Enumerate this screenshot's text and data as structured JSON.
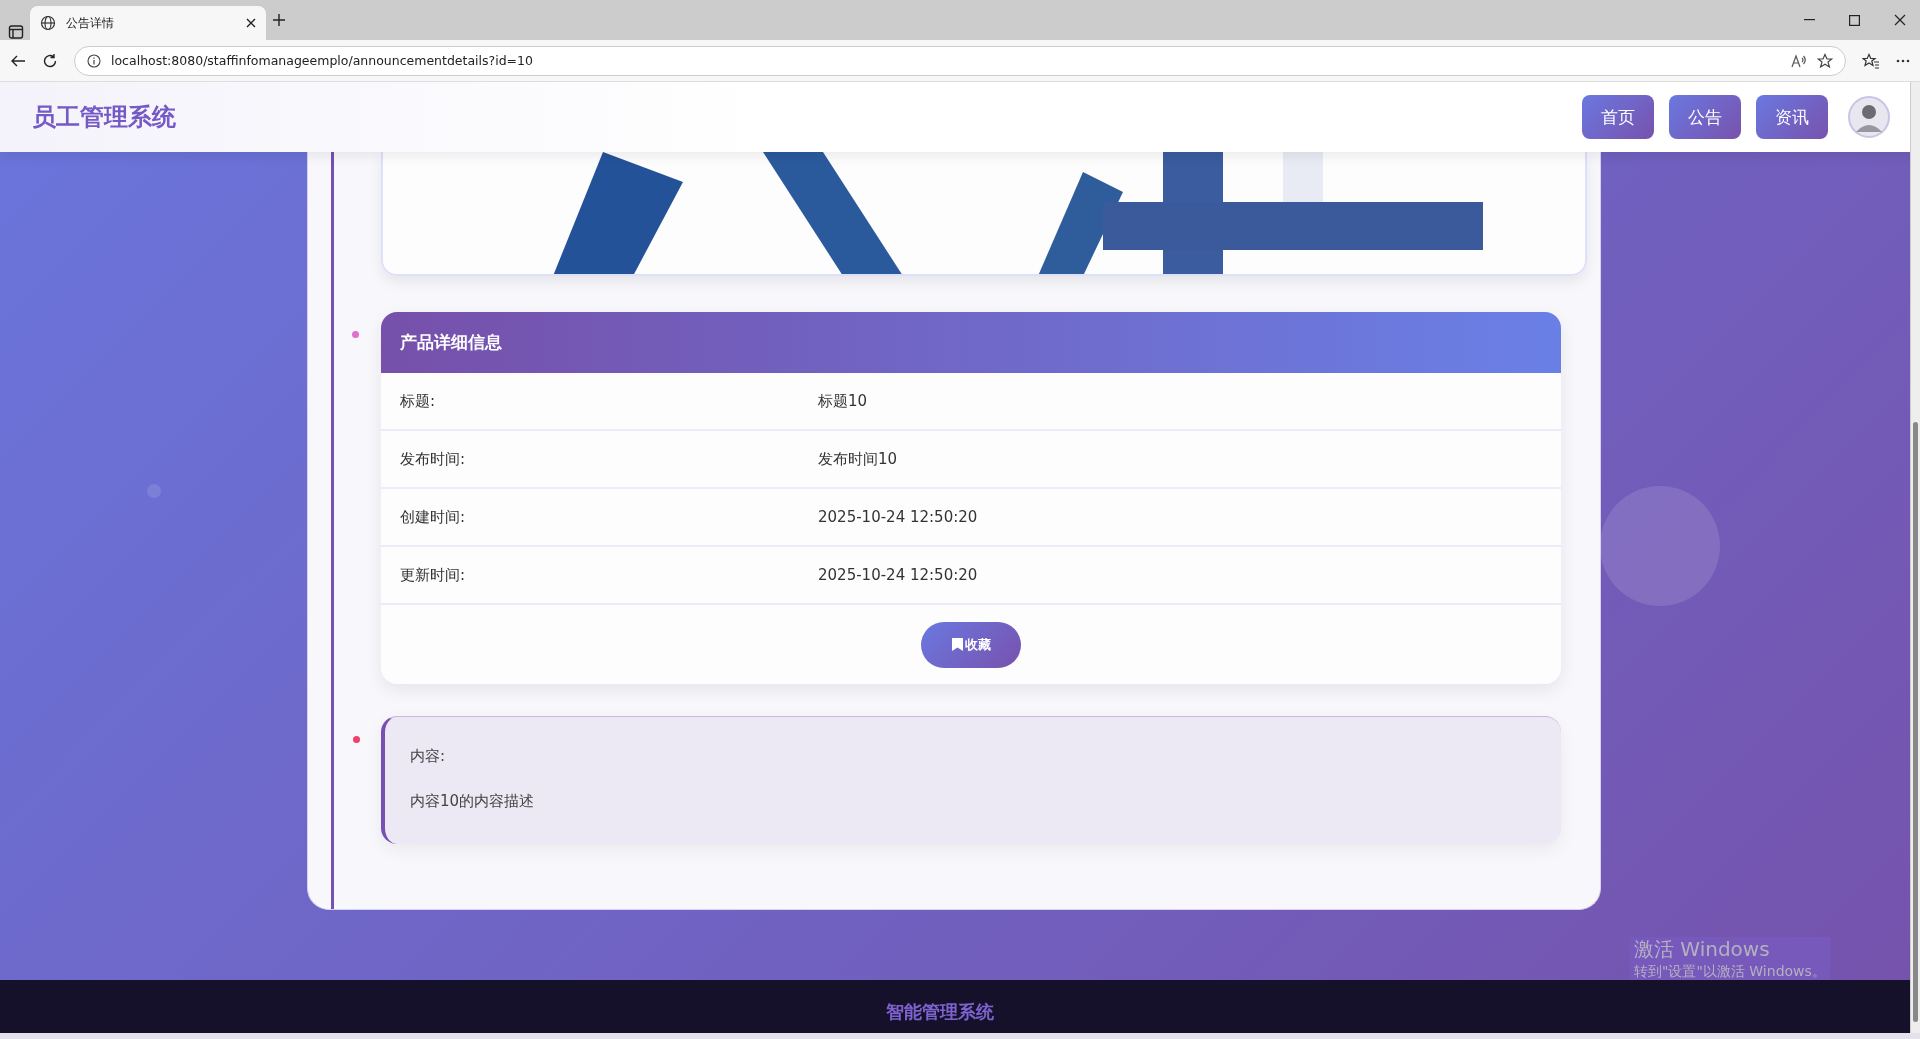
{
  "browser": {
    "tab_title": "公告详情",
    "url": "localhost:8080/staffinfomanageemplo/announcementdetails?id=10"
  },
  "navbar": {
    "brand": "员工管理系统",
    "nav_buttons": [
      {
        "label": "首页"
      },
      {
        "label": "公告"
      },
      {
        "label": "资讯"
      }
    ]
  },
  "details": {
    "title": "产品详细信息",
    "rows": [
      {
        "label": "标题:",
        "value": "标题10"
      },
      {
        "label": "发布时间:",
        "value": "发布时间10"
      },
      {
        "label": "创建时间:",
        "value": "2025-10-24 12:50:20"
      },
      {
        "label": "更新时间:",
        "value": "2025-10-24 12:50:20"
      }
    ],
    "action_button": "收藏"
  },
  "content": {
    "label": "内容:",
    "text": "内容10的内容描述"
  },
  "footer": {
    "brand": "智能管理系统"
  },
  "os_notice": {
    "title": "激活 Windows",
    "subtitle": "转到\"设置\"以激活 Windows。"
  }
}
